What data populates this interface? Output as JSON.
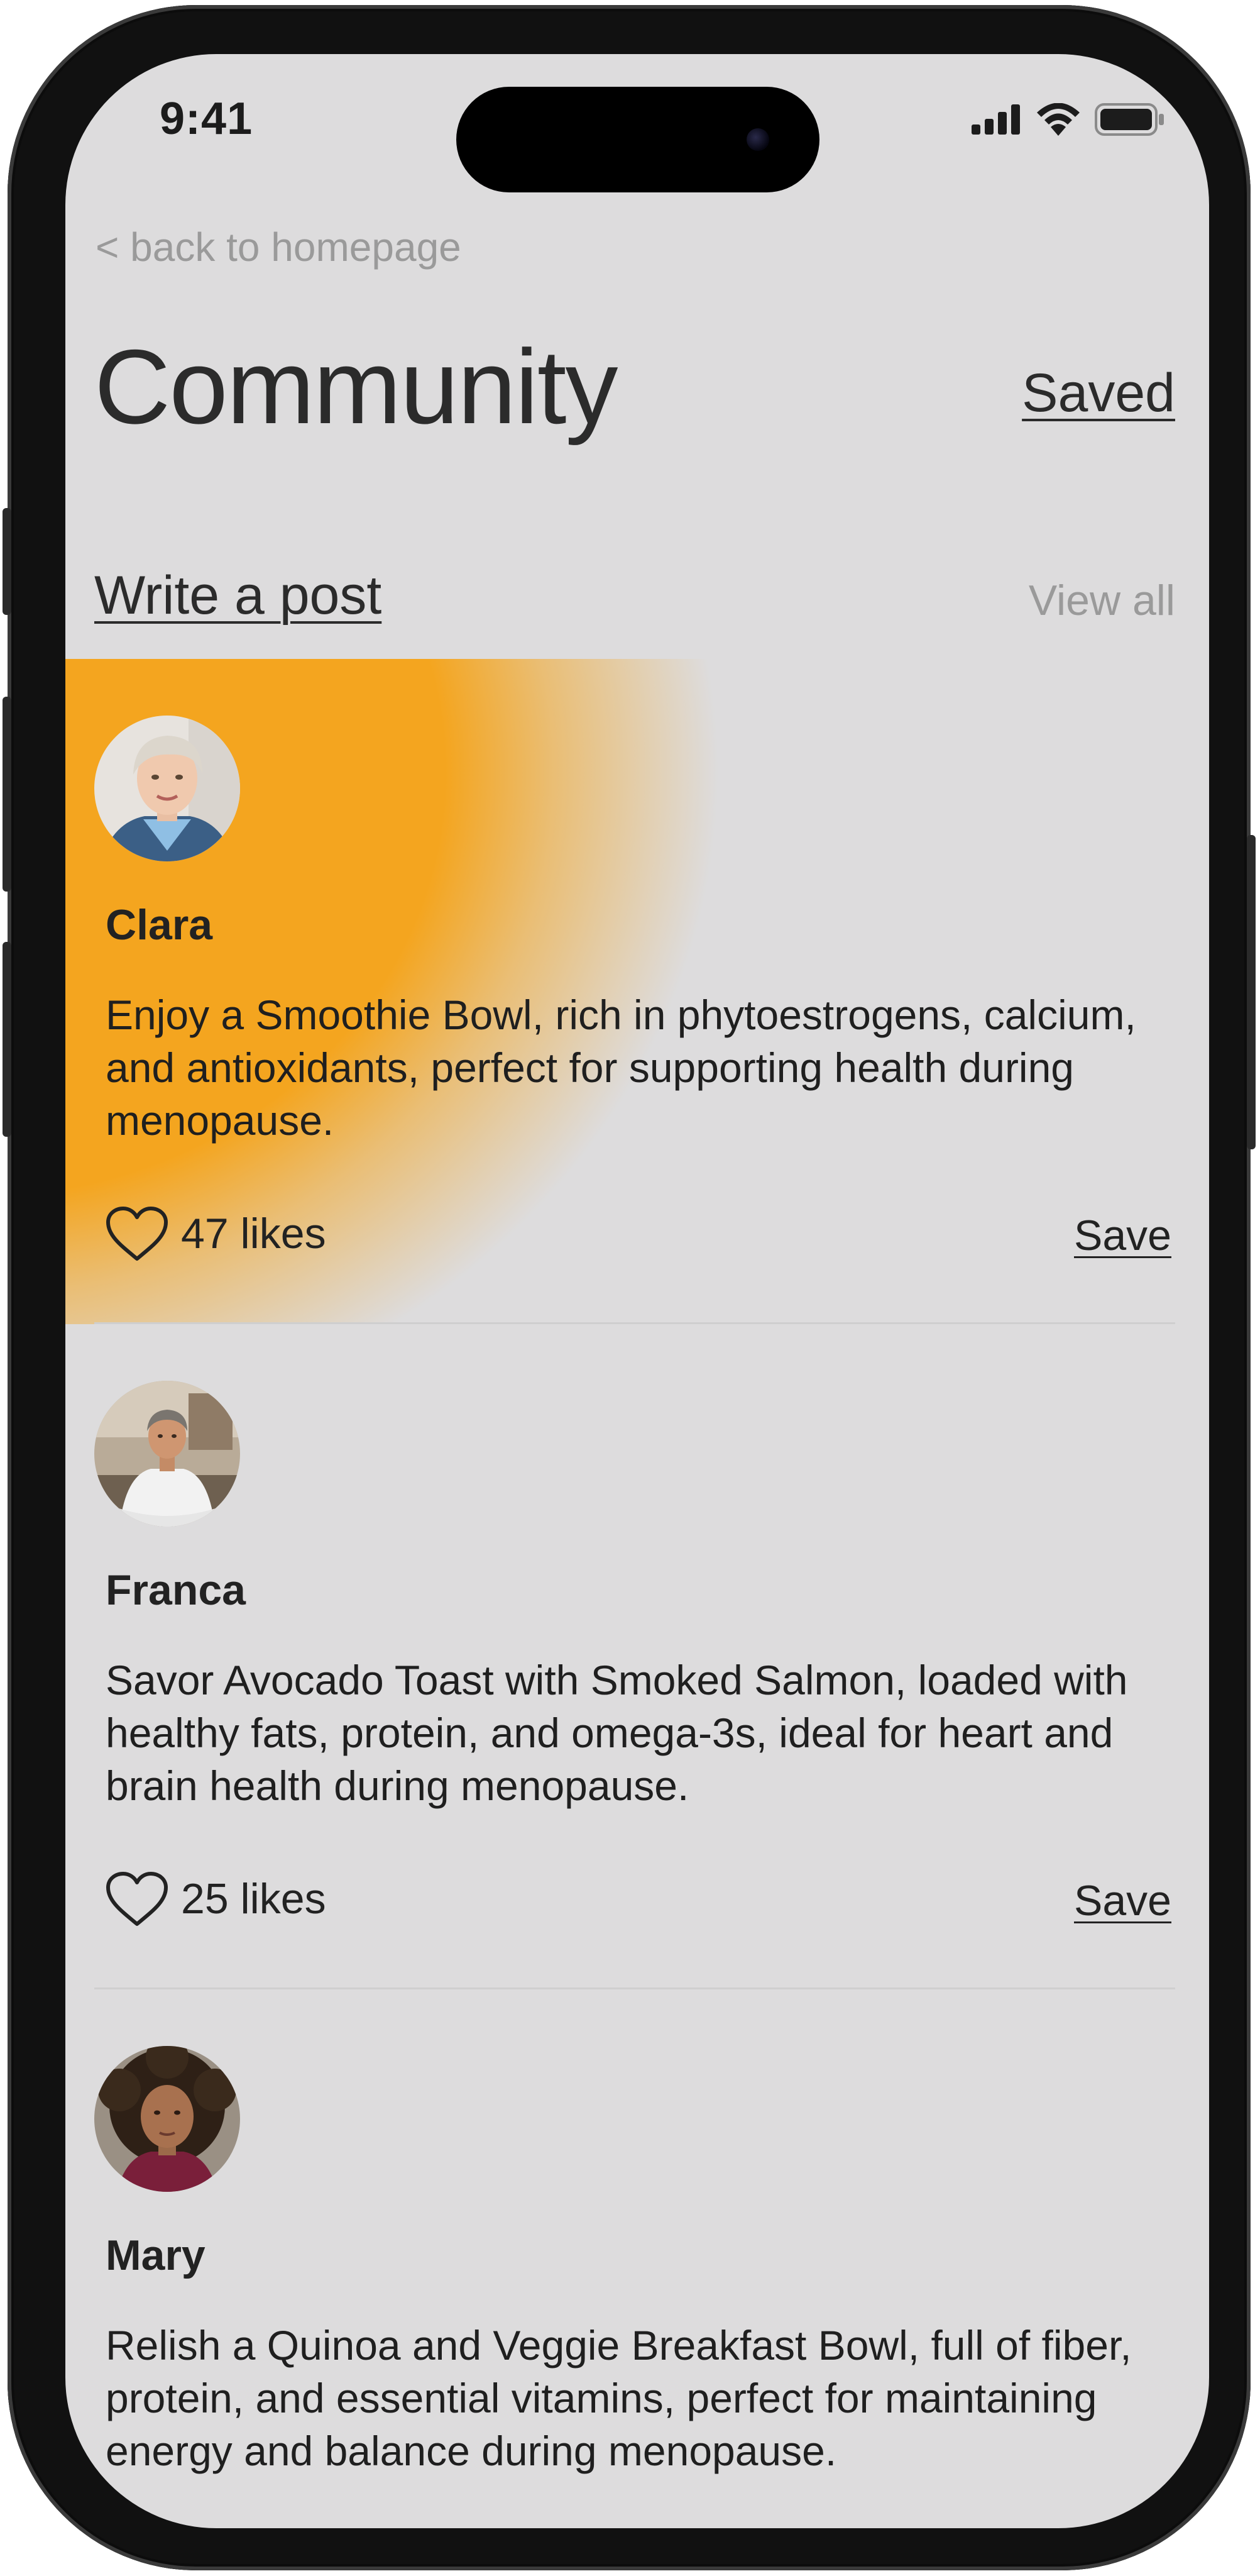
{
  "status_bar": {
    "time": "9:41",
    "icons": [
      "signal-icon",
      "wifi-icon",
      "battery-icon"
    ]
  },
  "header": {
    "back_label": "< back to homepage",
    "title": "Community",
    "saved_label": "Saved"
  },
  "actions": {
    "write_post_label": "Write a post",
    "view_all_label": "View all"
  },
  "colors": {
    "screen_background": "#dddcdd",
    "highlight": "#f4a51f",
    "text": "#2b2b2b",
    "muted_text": "#9a9a9a"
  },
  "posts": [
    {
      "author": "Clara",
      "text": "Enjoy a Smoothie Bowl, rich in phytoestrogens, calcium, and antioxidants, perfect for supporting health during menopause.",
      "likes_label": "47 likes",
      "save_label": "Save",
      "highlighted": true
    },
    {
      "author": "Franca",
      "text": "Savor Avocado Toast with Smoked Salmon, loaded with healthy fats, protein, and omega-3s, ideal for heart and brain health during menopause.",
      "likes_label": "25 likes",
      "save_label": "Save",
      "highlighted": false
    },
    {
      "author": "Mary",
      "text": "Relish a Quinoa and Veggie Breakfast Bowl, full of fiber, protein, and essential vitamins, perfect for maintaining energy and balance during menopause.",
      "highlighted": false
    }
  ]
}
